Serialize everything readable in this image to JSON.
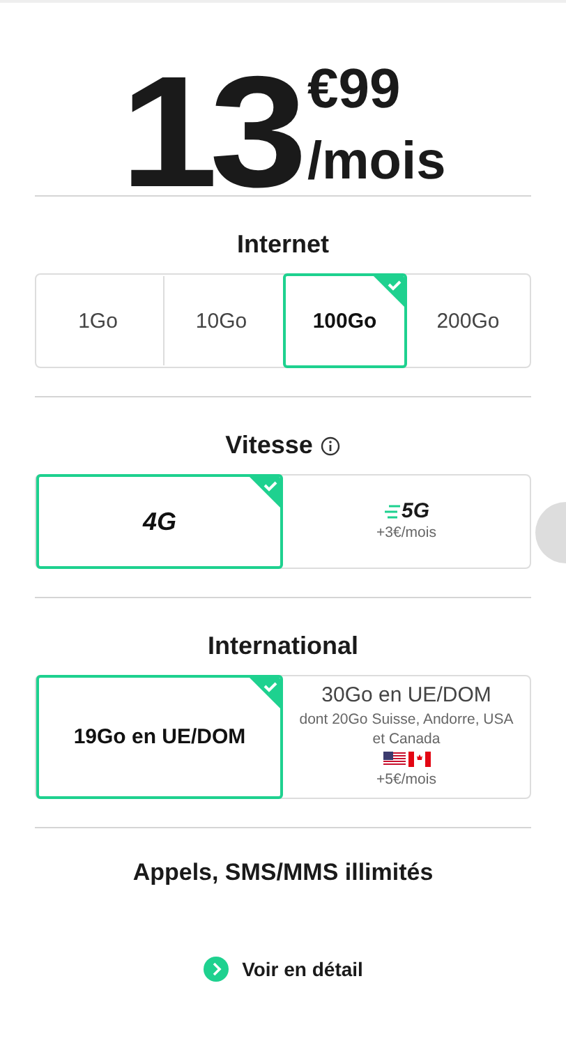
{
  "price": {
    "whole": "13",
    "cents": "€99",
    "period": "/mois"
  },
  "sections": [
    {
      "title": "Internet",
      "info": false,
      "kind": "compact",
      "options": [
        {
          "label": "1Go",
          "selected": false
        },
        {
          "label": "10Go",
          "selected": false
        },
        {
          "label": "100Go",
          "selected": true
        },
        {
          "label": "200Go",
          "selected": false
        }
      ]
    },
    {
      "title": "Vitesse",
      "info": true,
      "kind": "wide",
      "options": [
        {
          "label": "4G",
          "selected": true
        },
        {
          "label": "5G",
          "speed_lines": true,
          "price": "+3€/mois",
          "selected": false
        }
      ]
    },
    {
      "title": "International",
      "info": false,
      "kind": "wide",
      "options": [
        {
          "label": "19Go en UE/DOM",
          "selected": true
        },
        {
          "label": "30Go en UE/DOM",
          "detail": "dont 20Go Suisse, Andorre, USA et Canada",
          "flags": true,
          "price": "+5€/mois",
          "selected": false
        }
      ]
    }
  ],
  "included": "Appels, SMS/MMS illimités",
  "details_link": "Voir en détail"
}
